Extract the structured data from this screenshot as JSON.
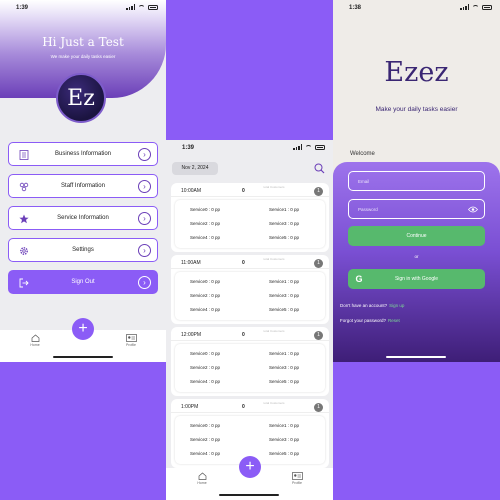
{
  "phone1": {
    "status_time": "1:39",
    "greeting": "Hi Just a Test",
    "subtitle": "We make your daily tasks easier",
    "logo_text": "Ez",
    "menu": [
      {
        "label": "Business Information",
        "icon": "document-icon"
      },
      {
        "label": "Staff Information",
        "icon": "team-icon"
      },
      {
        "label": "Service Information",
        "icon": "star-icon"
      },
      {
        "label": "Settings",
        "icon": "gear-icon"
      },
      {
        "label": "Sign Out",
        "icon": "sign-out-icon"
      }
    ],
    "tabbar": {
      "home": "Home",
      "profile": "Profile"
    }
  },
  "phone2": {
    "status_time": "1:39",
    "date": "Nov 2, 2024",
    "slots": [
      {
        "time": "10:00AM",
        "count": "0",
        "extra": "total Customers",
        "badge": "1",
        "services": [
          "Service0 : 0 pp",
          "Service1 : 0 pp",
          "Service2 : 0 pp",
          "Service3 : 0 pp",
          "Service4 : 0 pp",
          "Service5 : 0 pp"
        ]
      },
      {
        "time": "11:00AM",
        "count": "0",
        "extra": "total Customers",
        "badge": "1",
        "services": [
          "Service0 : 0 pp",
          "Service1 : 0 pp",
          "Service2 : 0 pp",
          "Service3 : 0 pp",
          "Service4 : 0 pp",
          "Service5 : 0 pp"
        ]
      },
      {
        "time": "12:00PM",
        "count": "0",
        "extra": "total Customers",
        "badge": "1",
        "services": [
          "Service0 : 0 pp",
          "Service1 : 0 pp",
          "Service2 : 0 pp",
          "Service3 : 0 pp",
          "Service4 : 0 pp",
          "Service5 : 0 pp"
        ]
      },
      {
        "time": "1:00PM",
        "count": "0",
        "extra": "total Customers",
        "badge": "1",
        "services": [
          "Service0 : 0 pp",
          "Service1 : 0 pp",
          "Service2 : 0 pp",
          "Service3 : 0 pp",
          "Service4 : 0 pp",
          "Service5 : 0 pp"
        ]
      }
    ],
    "tabbar": {
      "home": "Home",
      "profile": "Profile"
    }
  },
  "phone3": {
    "status_time": "1:38",
    "brand": "Ezez",
    "tagline": "Make your daily tasks easier",
    "welcome": "Welcome",
    "email_placeholder": "Email",
    "password_placeholder": "Password",
    "continue_label": "Continue",
    "or_label": "or",
    "google_label": "Sign in with Google",
    "no_account_text": "Don't have an account?",
    "sign_up_link": "Sign up",
    "forgot_text": "Forgot your password?",
    "reset_link": "Reset"
  },
  "colors": {
    "accent": "#8B5CF6",
    "dark_purple": "#3A2673",
    "green": "#57B96D",
    "background": "#8B5CF6"
  }
}
